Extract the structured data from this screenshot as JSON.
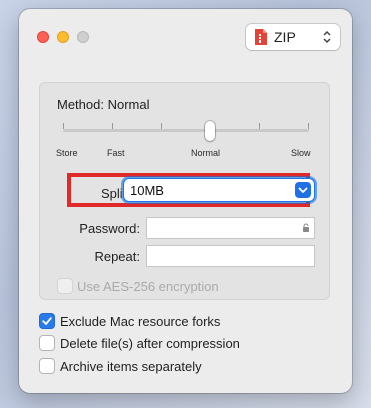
{
  "toolbar": {
    "format_value": "ZIP"
  },
  "compression": {
    "method_label": "Method: Normal",
    "level_labels": [
      "Store",
      "Fast",
      "Normal",
      "Slow"
    ],
    "selected_level": "Normal"
  },
  "split": {
    "label": "Split:",
    "value": "10MB"
  },
  "password": {
    "password_label": "Password:",
    "repeat_label": "Repeat:",
    "aes_label": "Use AES-256 encryption",
    "aes_checked": false
  },
  "options": [
    {
      "label": "Exclude Mac resource forks",
      "checked": true
    },
    {
      "label": "Delete file(s) after compression",
      "checked": false
    },
    {
      "label": "Archive items separately",
      "checked": false
    }
  ],
  "colors": {
    "accent": "#2a7bea",
    "highlight_box": "#e02a2a"
  }
}
